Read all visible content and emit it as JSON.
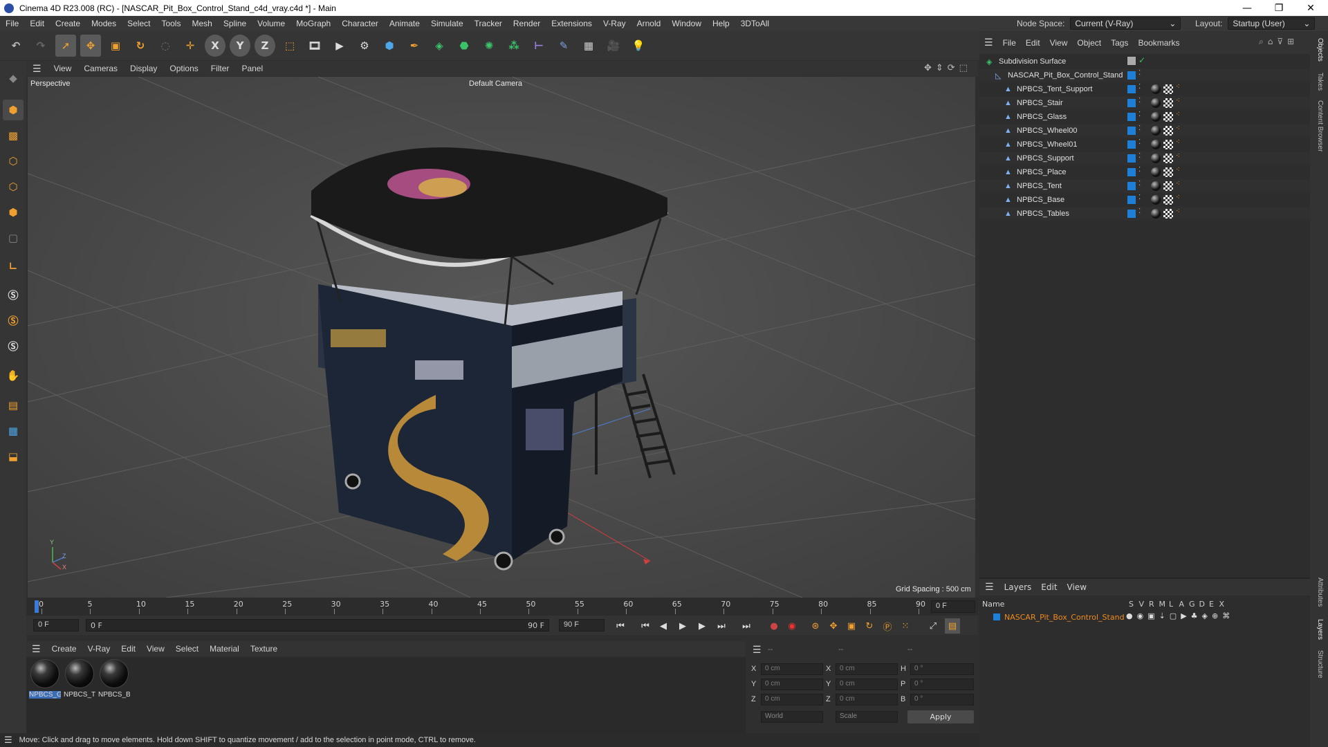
{
  "window": {
    "title": "Cinema 4D R23.008 (RC) - [NASCAR_Pit_Box_Control_Stand_c4d_vray.c4d *] - Main",
    "minimize": "—",
    "maximize": "❐",
    "close": "✕"
  },
  "menu": [
    "File",
    "Edit",
    "Create",
    "Modes",
    "Select",
    "Tools",
    "Mesh",
    "Spline",
    "Volume",
    "MoGraph",
    "Character",
    "Animate",
    "Simulate",
    "Tracker",
    "Render",
    "Extensions",
    "V-Ray",
    "Arnold",
    "Window",
    "Help",
    "3DToAll"
  ],
  "node_space": {
    "label": "Node Space:",
    "value": "Current (V-Ray)"
  },
  "layout": {
    "label": "Layout:",
    "value": "Startup (User)"
  },
  "toolbar": {
    "icons": [
      "undo-icon",
      "redo-icon",
      "select-icon",
      "move-icon",
      "scale-icon",
      "rotate-icon",
      "live-select-icon",
      "transform-icon",
      "x-axis-icon",
      "y-axis-icon",
      "z-axis-icon",
      "coord-system-icon",
      "render-view-icon",
      "render-picture-viewer-icon",
      "render-settings-icon",
      "cube-icon",
      "spline-pen-icon",
      "subdivision-icon",
      "extrude-icon",
      "cloner-icon",
      "array-icon",
      "deformer-icon",
      "sculpt-icon",
      "floor-icon",
      "camera-icon",
      "light-icon"
    ],
    "axis_labels": [
      "X",
      "Y",
      "Z"
    ]
  },
  "viewport": {
    "menu": [
      "View",
      "Cameras",
      "Display",
      "Options",
      "Filter",
      "Panel"
    ],
    "label": "Perspective",
    "camera": "Default Camera",
    "grid_spacing": "Grid Spacing : 500 cm",
    "axis_y": "Y",
    "axis_z": "Z",
    "axis_x": "X"
  },
  "timeline": {
    "ticks": [
      "0",
      "5",
      "10",
      "15",
      "20",
      "25",
      "30",
      "35",
      "40",
      "45",
      "50",
      "55",
      "60",
      "65",
      "70",
      "75",
      "80",
      "85",
      "90"
    ],
    "current_frame": "0 F"
  },
  "playback": {
    "start": "0 F",
    "range_start": "0 F",
    "range_end": "90 F",
    "end": "90 F"
  },
  "material_manager": {
    "menu": [
      "Create",
      "V-Ray",
      "Edit",
      "View",
      "Select",
      "Material",
      "Texture"
    ],
    "materials": [
      "NPBCS_G",
      "NPBCS_T",
      "NPBCS_B"
    ]
  },
  "coordinates": {
    "header": [
      "--",
      "--",
      "--"
    ],
    "rows": [
      {
        "a": "X",
        "av": "0 cm",
        "b": "X",
        "bv": "0 cm",
        "c": "H",
        "cv": "0 °"
      },
      {
        "a": "Y",
        "av": "0 cm",
        "b": "Y",
        "bv": "0 cm",
        "c": "P",
        "cv": "0 °"
      },
      {
        "a": "Z",
        "av": "0 cm",
        "b": "Z",
        "bv": "0 cm",
        "c": "B",
        "cv": "0 °"
      }
    ],
    "mode": "World",
    "transform": "Scale",
    "apply": "Apply"
  },
  "status": "Move: Click and drag to move elements. Hold down SHIFT to quantize movement / add to the selection in point mode, CTRL to remove.",
  "object_manager": {
    "menu": [
      "File",
      "Edit",
      "View",
      "Object",
      "Tags",
      "Bookmarks"
    ],
    "objects": [
      {
        "name": "Subdivision Surface",
        "indent": 0,
        "type": "subdiv"
      },
      {
        "name": "NASCAR_Pit_Box_Control_Stand",
        "indent": 1,
        "type": "null"
      },
      {
        "name": "NPBCS_Tent_Support",
        "indent": 2,
        "type": "mesh"
      },
      {
        "name": "NPBCS_Stair",
        "indent": 2,
        "type": "mesh"
      },
      {
        "name": "NPBCS_Glass",
        "indent": 2,
        "type": "mesh"
      },
      {
        "name": "NPBCS_Wheel00",
        "indent": 2,
        "type": "mesh"
      },
      {
        "name": "NPBCS_Wheel01",
        "indent": 2,
        "type": "mesh"
      },
      {
        "name": "NPBCS_Support",
        "indent": 2,
        "type": "mesh"
      },
      {
        "name": "NPBCS_Place",
        "indent": 2,
        "type": "mesh"
      },
      {
        "name": "NPBCS_Tent",
        "indent": 2,
        "type": "mesh"
      },
      {
        "name": "NPBCS_Base",
        "indent": 2,
        "type": "mesh"
      },
      {
        "name": "NPBCS_Tables",
        "indent": 2,
        "type": "mesh"
      }
    ]
  },
  "layers": {
    "menu": [
      "Layers",
      "Edit",
      "View"
    ],
    "col_name": "Name",
    "cols": [
      "S",
      "V",
      "R",
      "M",
      "L",
      "A",
      "G",
      "D",
      "E",
      "X"
    ],
    "rows": [
      {
        "name": "NASCAR_Pit_Box_Control_Stand",
        "color": "#1e7fd6"
      }
    ]
  },
  "side_tabs": [
    "Objects",
    "Takes",
    "Content Browser",
    "Attributes",
    "Layers",
    "Structure"
  ],
  "colors": {
    "accent": "#4a8fe0",
    "layer_text": "#f08a1e",
    "tag_blue": "#1e7fd6"
  }
}
